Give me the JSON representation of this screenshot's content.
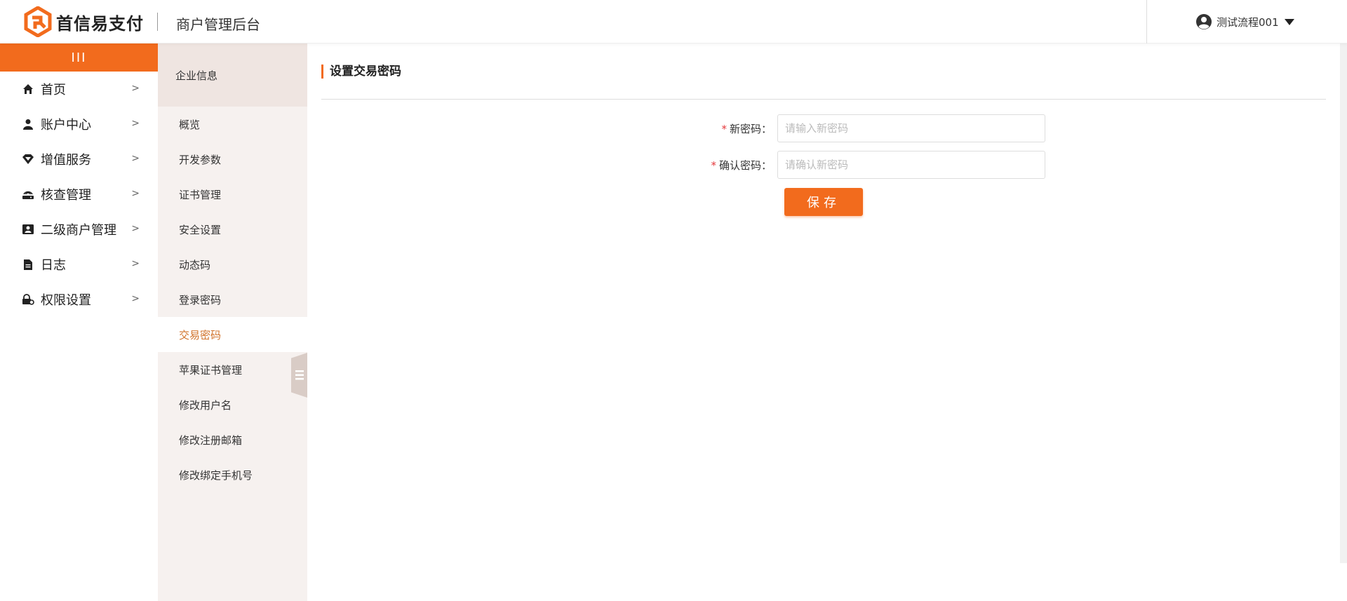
{
  "header": {
    "brand": "首信易支付",
    "subtitle": "商户管理后台",
    "user_name": "测试流程001"
  },
  "sidebar": {
    "collapse_label": "III",
    "items": [
      {
        "label": "首页",
        "icon": "home-icon"
      },
      {
        "label": "账户中心",
        "icon": "user-icon"
      },
      {
        "label": "增值服务",
        "icon": "diamond-icon"
      },
      {
        "label": "核查管理",
        "icon": "router-icon"
      },
      {
        "label": "二级商户管理",
        "icon": "contact-card-icon"
      },
      {
        "label": "日志",
        "icon": "document-icon"
      },
      {
        "label": "权限设置",
        "icon": "lock-gear-icon"
      }
    ]
  },
  "subpanel": {
    "title": "企业信息",
    "items": [
      "概览",
      "开发参数",
      "证书管理",
      "安全设置",
      "动态码",
      "登录密码",
      "交易密码",
      "苹果证书管理",
      "修改用户名",
      "修改注册邮箱",
      "修改绑定手机号"
    ],
    "active": "交易密码"
  },
  "main": {
    "title": "设置交易密码",
    "form": {
      "new_password_label": "新密码：",
      "new_password_placeholder": "请输入新密码",
      "confirm_password_label": "确认密码：",
      "confirm_password_placeholder": "请确认新密码",
      "required_mark": "*",
      "save_label": "保存"
    }
  },
  "colors": {
    "accent": "#f26b1d",
    "active_text": "#d1732b",
    "subpanel_bg": "#f6f1ef"
  }
}
